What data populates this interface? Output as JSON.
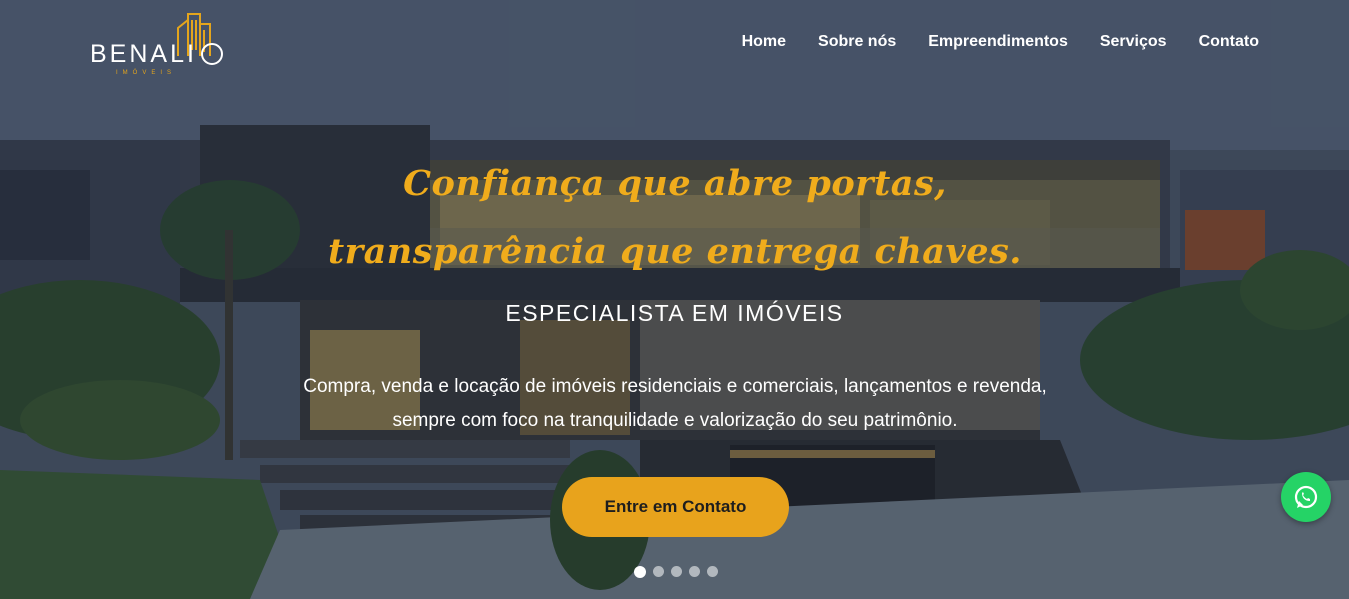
{
  "brand": {
    "name": "BENALI",
    "tagline": "IMÓVEIS"
  },
  "nav": {
    "items": [
      {
        "label": "Home"
      },
      {
        "label": "Sobre nós"
      },
      {
        "label": "Empreendimentos"
      },
      {
        "label": "Serviços"
      },
      {
        "label": "Contato"
      }
    ]
  },
  "hero": {
    "headline": "Confiança que abre portas, transparência que entrega chaves.",
    "subtitle": "ESPECIALISTA EM IMÓVEIS",
    "description": "Compra, venda e locação de imóveis residenciais e comerciais, lançamentos e revenda, sempre com foco na tranquilidade e valorização do seu patrimônio.",
    "cta_label": "Entre em Contato",
    "slides": {
      "count": 5,
      "active": 1
    }
  },
  "floating": {
    "icon": "whatsapp-icon"
  },
  "colors": {
    "accent": "#e8a31c",
    "headline": "#f0ac1c",
    "whatsapp": "#25d366",
    "text": "#ffffff"
  }
}
